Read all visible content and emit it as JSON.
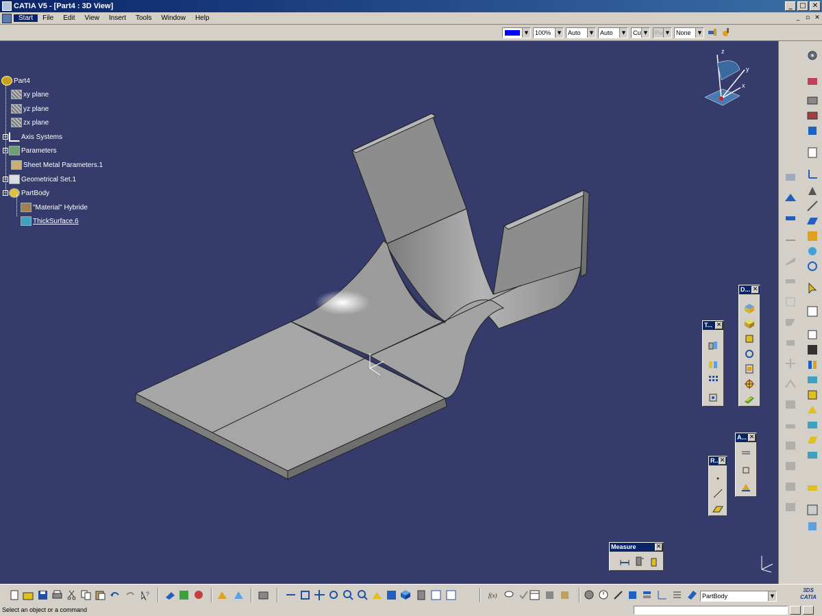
{
  "window": {
    "title": "CATIA V5 - [Part4 : 3D View]",
    "minimize": "_",
    "maximize": "□",
    "close": "✕"
  },
  "menu": {
    "items": [
      "Start",
      "File",
      "Edit",
      "View",
      "Insert",
      "Tools",
      "Window",
      "Help"
    ],
    "active": "Start",
    "doc_min": "_",
    "doc_max": "▫",
    "doc_close": "✕"
  },
  "properties": {
    "color": "#0000ff",
    "transparency": "100%",
    "line_thickness": "Auto",
    "line_type": "Auto",
    "point_symbol": "Cut",
    "point_disabled": "Put",
    "layer": "None",
    "dd": "▼"
  },
  "tree": {
    "root": "Part4",
    "items": [
      "xy plane",
      "yz plane",
      "zx plane",
      "Axis Systems",
      "Parameters",
      "Sheet Metal Parameters.1",
      "Geometrical Set.1",
      "PartBody",
      "\"Material\" Hybride",
      "ThickSurface.6"
    ],
    "expand": "+",
    "collapse": "−"
  },
  "floating_toolbars": {
    "d_title": "D...",
    "t_title": "T...",
    "a_title": "A...",
    "r_title": "R...",
    "measure_title": "Measure",
    "close": "✕"
  },
  "bottom_toolbar": {
    "current_body": "PartBody",
    "dd": "▼"
  },
  "status": {
    "message": "Select an object or a command"
  },
  "compass": {
    "x": "x",
    "y": "y",
    "z": "z"
  },
  "logo": {
    "line1": "3DS",
    "line2": "CATIA"
  },
  "colors": {
    "viewport_bg": "#353b6b",
    "part_face": "#9a9a9a",
    "titlebar": "#0a246a"
  }
}
